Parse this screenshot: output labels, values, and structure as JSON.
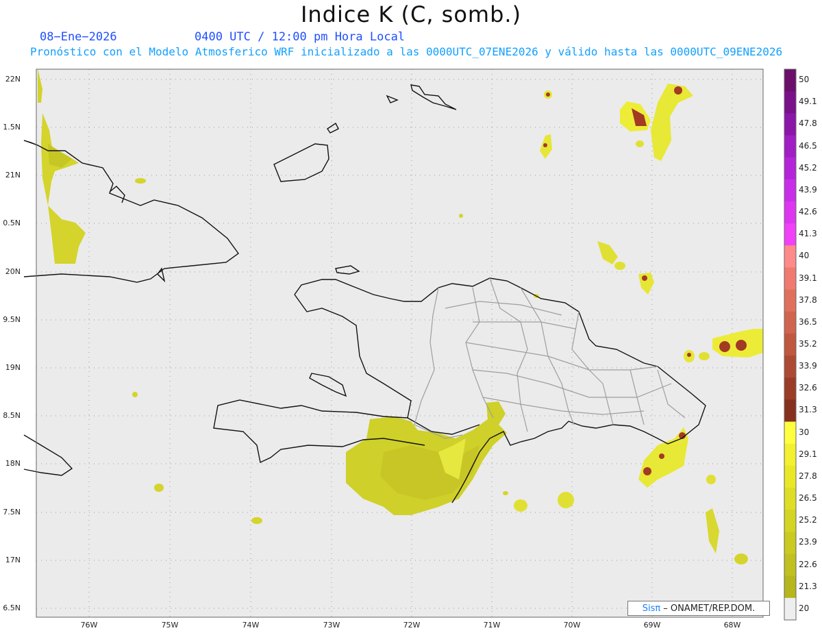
{
  "header": {
    "title": "Indice K (C, somb.)",
    "date": "08−Ene−2026",
    "time": "0400 UTC / 12:00 pm Hora Local",
    "model_line": "Pronóstico con el Modelo Atmosferico WRF inicializado a las 0000UTC_07ENE2026 y válido hasta las  0000UTC_09ENE2026"
  },
  "axes": {
    "lat_labels": [
      "22N",
      "1.5N",
      "21N",
      "0.5N",
      "20N",
      "9.5N",
      "19N",
      "8.5N",
      "18N",
      "7.5N",
      "17N",
      "6.5N"
    ],
    "lon_labels": [
      "76W",
      "75W",
      "74W",
      "73W",
      "72W",
      "71W",
      "70W",
      "69W",
      "68W"
    ]
  },
  "colorbar": {
    "labels": [
      "50",
      "49.1",
      "47.8",
      "46.5",
      "45.2",
      "43.9",
      "42.6",
      "41.3",
      "40",
      "39.1",
      "37.8",
      "36.5",
      "35.2",
      "33.9",
      "32.6",
      "31.3",
      "30",
      "29.1",
      "27.8",
      "26.5",
      "25.2",
      "23.9",
      "22.6",
      "21.3",
      "20"
    ],
    "colors": [
      "#6b0f6b",
      "#7a108a",
      "#8c16a8",
      "#a01ec4",
      "#b424d8",
      "#c82ee8",
      "#dc36f0",
      "#f040f8",
      "#ff8a8a",
      "#f07a70",
      "#e0705e",
      "#d0644e",
      "#c05840",
      "#ad4a34",
      "#9a3c28",
      "#86301e",
      "#ffff40",
      "#f2f030",
      "#e8e828",
      "#dede26",
      "#d4d424",
      "#caca22",
      "#c0c020",
      "#b6b61e",
      "#eeeeee"
    ]
  },
  "credit": {
    "sis": "Sisπ",
    "text": "– ONAMET/REP.DOM."
  }
}
